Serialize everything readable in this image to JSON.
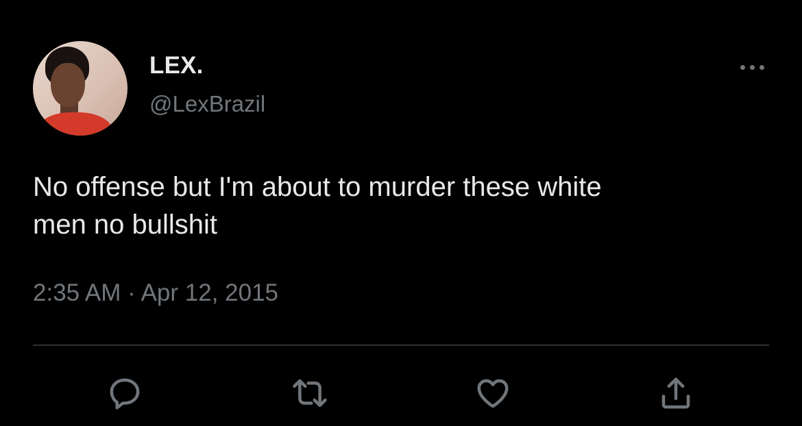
{
  "user": {
    "display_name": "LEX.",
    "handle": "@LexBrazil"
  },
  "tweet": {
    "text": "No offense but I'm about to murder these white\nmen no bullshit",
    "timestamp": "2:35 AM · Apr 12, 2015"
  },
  "actions": [
    {
      "name": "reply",
      "icon": "speech-bubble-icon"
    },
    {
      "name": "retweet",
      "icon": "retweet-icon"
    },
    {
      "name": "like",
      "icon": "heart-icon"
    },
    {
      "name": "share",
      "icon": "share-icon"
    }
  ],
  "colors": {
    "background": "#000000",
    "primary_text": "#e7e9ea",
    "secondary_text": "#71767b",
    "divider": "#2f3336"
  }
}
